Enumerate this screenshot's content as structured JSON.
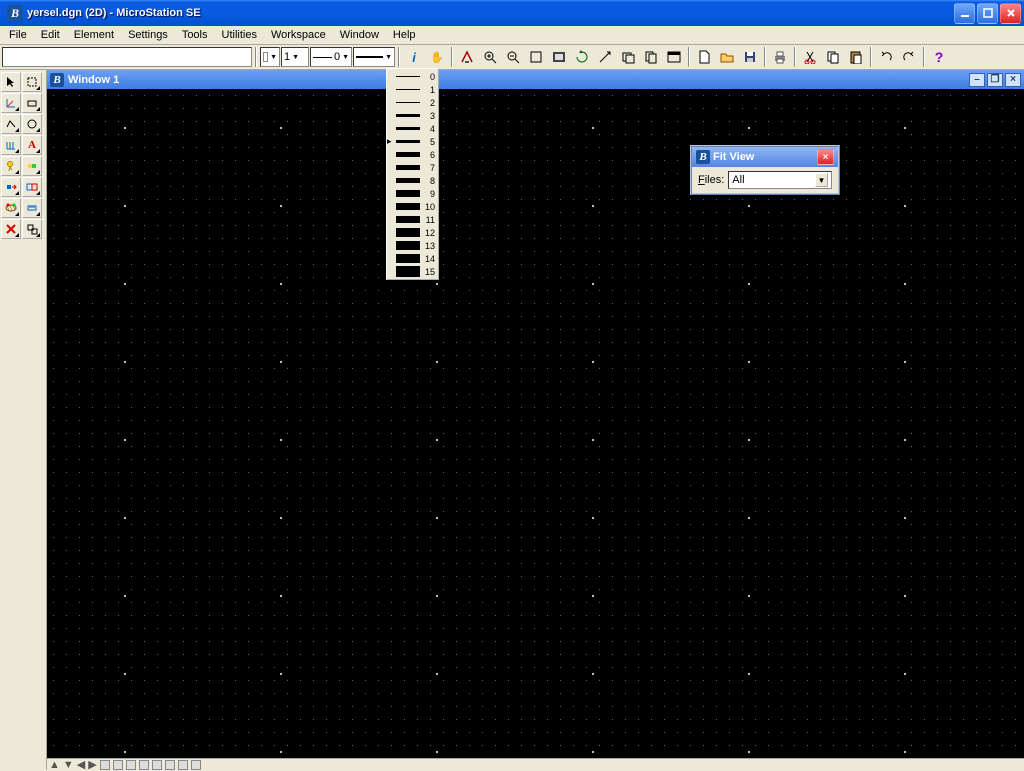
{
  "titlebar": {
    "title": "yersel.dgn (2D) - MicroStation SE"
  },
  "menu": [
    "File",
    "Edit",
    "Element",
    "Settings",
    "Tools",
    "Utilities",
    "Workspace",
    "Window",
    "Help"
  ],
  "toolbar": {
    "level_combo": "1",
    "linestyle_combo": "0"
  },
  "inner_window": {
    "title": "Window 1"
  },
  "weight_popup": {
    "items": [
      0,
      1,
      2,
      3,
      4,
      5,
      6,
      7,
      8,
      9,
      10,
      11,
      12,
      13,
      14,
      15
    ],
    "selected": 5
  },
  "fit_view": {
    "title": "Fit View",
    "label": "Files:",
    "value": "All"
  },
  "bottom": {
    "arrows": "▲▼◀▶"
  }
}
